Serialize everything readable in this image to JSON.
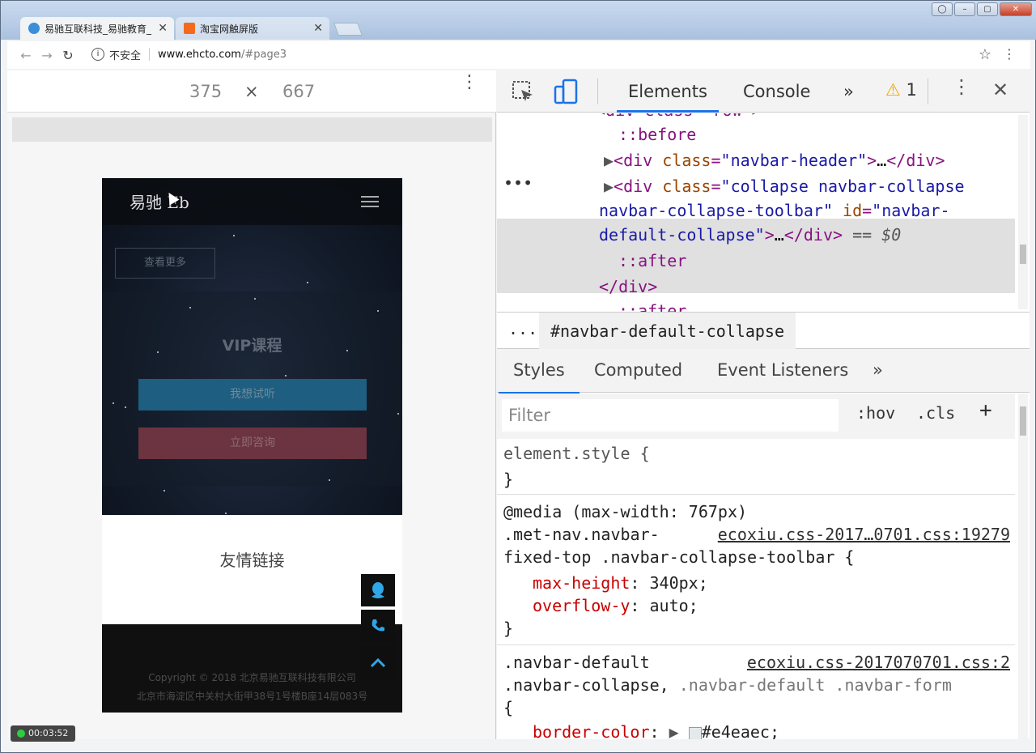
{
  "tabs": [
    {
      "title": "易驰互联科技_易驰教育_",
      "active": true
    },
    {
      "title": "淘宝网触屏版",
      "active": false
    }
  ],
  "address": {
    "security": "不安全",
    "host": "www.ehcto.com",
    "path": "/#page3"
  },
  "device": {
    "width": "375",
    "times": "×",
    "height": "667"
  },
  "phone": {
    "logo": "易驰 Eb",
    "more_button": "查看更多",
    "heading": "VIP课程",
    "listen_button": "我想试听",
    "consult_button": "立即咨询",
    "friend_links": "友情链接",
    "copyright": "Copyright © 2018 北京易驰互联科技有限公司",
    "address": "北京市海淀区中关村大街甲38号1号楼B座14层083号"
  },
  "recorder": {
    "time": "00:03:52"
  },
  "devtools": {
    "tabs": [
      "Elements",
      "Console"
    ],
    "more_tabs": "»",
    "warning_count": "1",
    "dom": {
      "line0": "<div class=\"row\">",
      "line1": "::before",
      "line2_tag": "<div class=\"navbar-header\">…</div>",
      "line3a": "<div class=\"collapse navbar-collapse",
      "line3b": "navbar-collapse-toolbar\" id=\"navbar-",
      "line3c": "default-collapse\">…</div> == $0",
      "line4": "::after",
      "line5": "</div>",
      "line6": "::after"
    },
    "breadcrumb": "#navbar-default-collapse",
    "breadcrumb_dots": "...",
    "style_tabs": [
      "Styles",
      "Computed",
      "Event Listeners"
    ],
    "filter_placeholder": "Filter",
    "hov": ":hov",
    "cls": ".cls",
    "add": "+",
    "rules": {
      "element_style": "element.style {",
      "close": "}",
      "media": "@media (max-width: 767px)",
      "sel1a": ".met-nav.navbar-",
      "src1": "ecoxiu.css-2017…0701.css:19279",
      "sel1b": "fixed-top .navbar-collapse-toolbar {",
      "p1_name": "max-height",
      "p1_val": "340px;",
      "p2_name": "overflow-y",
      "p2_val": "auto;",
      "sel2a": ".navbar-default",
      "src2": "ecoxiu.css-2017070701.css:2",
      "sel2b": ".navbar-collapse,",
      "sel2b_dim": ".navbar-default .navbar-form",
      "brace": "{",
      "p3_name": "border-color",
      "p3_val": "#e4eaec;"
    }
  }
}
